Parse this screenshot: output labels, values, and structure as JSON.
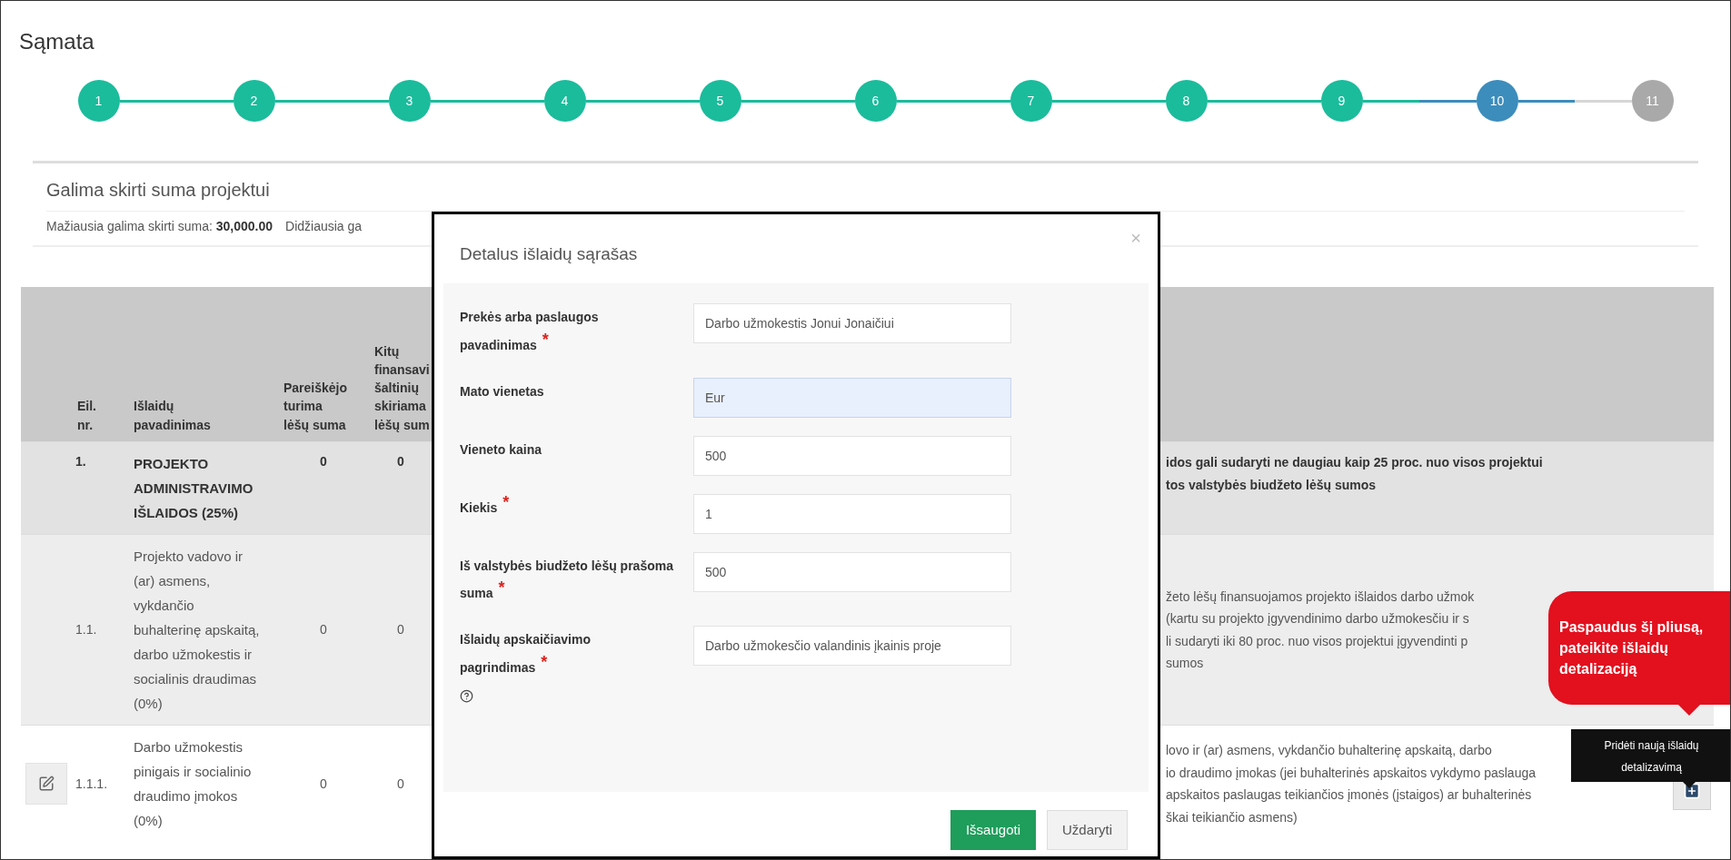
{
  "page_title": "Sąmata",
  "steps": [
    {
      "label": "1",
      "selected": false
    },
    {
      "label": "2",
      "selected": false
    },
    {
      "label": "3",
      "selected": false
    },
    {
      "label": "4",
      "selected": false
    },
    {
      "label": "5",
      "selected": false
    },
    {
      "label": "6",
      "selected": false
    },
    {
      "label": "7",
      "selected": false
    },
    {
      "label": "8",
      "selected": false
    },
    {
      "label": "9",
      "selected": false
    },
    {
      "label": "10",
      "selected": true
    },
    {
      "label": "11",
      "selected": false
    }
  ],
  "summary": {
    "title": "Galima skirti suma projektui",
    "min_label": "Mažiausia galima skirti suma:",
    "min_value": "30,000.00",
    "max_label": "Didžiausia ga"
  },
  "table": {
    "columns": [
      "Eil.\nnr.",
      "Išlaidų\npavadinimas",
      "Pareiškėjo\nturima\nlėšų suma",
      "Kitų\nfinansavi\nšaltinių\nskiriama\nlėšų sum"
    ],
    "rows": [
      {
        "kind": "category",
        "nr": "1.",
        "name": "PROJEKTO ADMINISTRAVIMO IŠLAIDOS (25%)",
        "col3": "0",
        "col4": "0",
        "description": "idos gali sudaryti ne daugiau kaip 25 proc. nuo visos projektui\ntos valstybės biudžeto lėšų sumos"
      },
      {
        "kind": "subcategory",
        "nr": "1.1.",
        "name": "Projekto vadovo ir (ar) asmens, vykdančio buhalterinę apskaitą, darbo užmokestis ir socialinis draudimas (0%)",
        "col3": "0",
        "col4": "0",
        "description": "žeto lėšų finansuojamos projekto išlaidos darbo užmok\n(kartu su projekto įgyvendinimo darbo užmokesčiu ir s\nli sudaryti iki 80 proc. nuo visos projektui įgyvendinti p\nsumos"
      },
      {
        "kind": "item",
        "nr": "1.1.1.",
        "name": "Darbo užmokestis pinigais ir socialinio draudimo įmokos (0%)",
        "col3": "0",
        "col4": "0",
        "description": "lovo ir (ar) asmens, vykdančio buhalterinę apskaitą, darbo\nio draudimo įmokas (jei buhalterinės apskaitos vykdymo paslauga\napskaitos paslaugas teikiančios įmonės (įstaigos) ar buhalterinės\nškai teikiančio asmens)"
      }
    ]
  },
  "modal": {
    "title": "Detalus išlaidų sąrašas",
    "close": "×",
    "fields": [
      {
        "label": "Prekės arba paslaugos pavadinimas",
        "required_mark": "*",
        "help": false,
        "value": "Darbo užmokestis Jonui Jonaičiui",
        "highlighted": false
      },
      {
        "label": "Mato vienetas",
        "help": false,
        "value": "Eur",
        "highlighted": true
      },
      {
        "label": "Vieneto kaina",
        "help": false,
        "value": "500",
        "highlighted": false
      },
      {
        "label": "Kiekis",
        "required_mark": "*",
        "help": false,
        "value": "1",
        "highlighted": false
      },
      {
        "label": "Iš valstybės biudžeto lėšų prašoma suma",
        "required_mark": "*",
        "help": false,
        "value": "500",
        "highlighted": false
      },
      {
        "label": "Išlaidų apskaičiavimo pagrindimas",
        "required_mark": "*",
        "help": true,
        "value": "Darbo užmokesčio valandinis įkainis proje",
        "highlighted": false
      }
    ],
    "buttons": [
      {
        "label": "Išsaugoti",
        "kind": "primary"
      },
      {
        "label": "Uždaryti",
        "kind": "default"
      }
    ]
  },
  "callout": {
    "text": "Paspaudus šį pliusą, pateikite išlaidų detalizaciją"
  },
  "tooltip": {
    "text": "Pridėti naują išlaidų detalizavimą"
  }
}
